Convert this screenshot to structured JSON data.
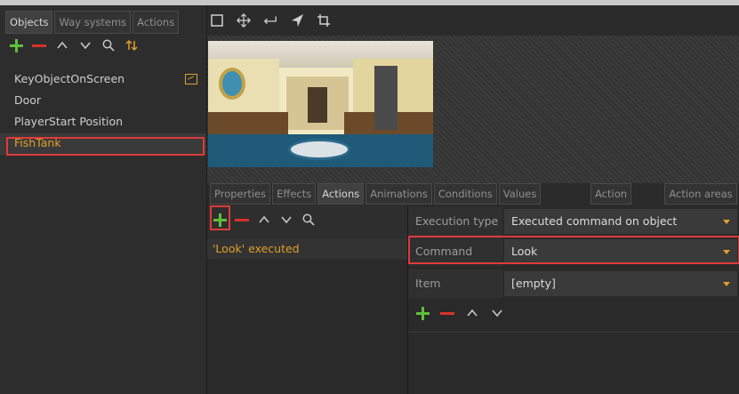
{
  "left_panel": {
    "tabs": [
      {
        "label": "Objects",
        "active": true
      },
      {
        "label": "Way systems",
        "active": false
      },
      {
        "label": "Actions",
        "active": false
      }
    ],
    "toolbar": [
      "add-icon",
      "remove-icon",
      "move-up-icon",
      "move-down-icon",
      "search-icon",
      "sort-icon"
    ],
    "objects": [
      {
        "name": "KeyObjectOnScreen",
        "has_image_icon": true
      },
      {
        "name": "Door"
      },
      {
        "name": "PlayerStart Position"
      },
      {
        "name": "FishTank",
        "selected": true
      }
    ]
  },
  "top_toolbar": [
    "select-rectangle-icon",
    "move-icon",
    "enter-arrow-icon",
    "pointer-icon",
    "crop-icon"
  ],
  "bottom_tabs": {
    "tabs": [
      {
        "label": "Properties",
        "active": false
      },
      {
        "label": "Effects",
        "active": false
      },
      {
        "label": "Actions",
        "active": true
      },
      {
        "label": "Animations",
        "active": false
      },
      {
        "label": "Conditions",
        "active": false
      },
      {
        "label": "Values",
        "active": false
      }
    ],
    "right_tabs": [
      {
        "label": "Action"
      },
      {
        "label": "Action areas"
      }
    ]
  },
  "actions_list": {
    "items": [
      {
        "label": "'Look' executed"
      }
    ]
  },
  "properties": {
    "rows": [
      {
        "label": "Execution type",
        "value": "Executed command on object"
      },
      {
        "label": "Command",
        "value": "Look"
      },
      {
        "label": "Item",
        "value": "[empty]"
      }
    ]
  },
  "colors": {
    "accent_orange": "#e0a02a",
    "add_green": "#5ec03a",
    "remove_red": "#d8322c",
    "highlight_red": "#e03a3a"
  }
}
